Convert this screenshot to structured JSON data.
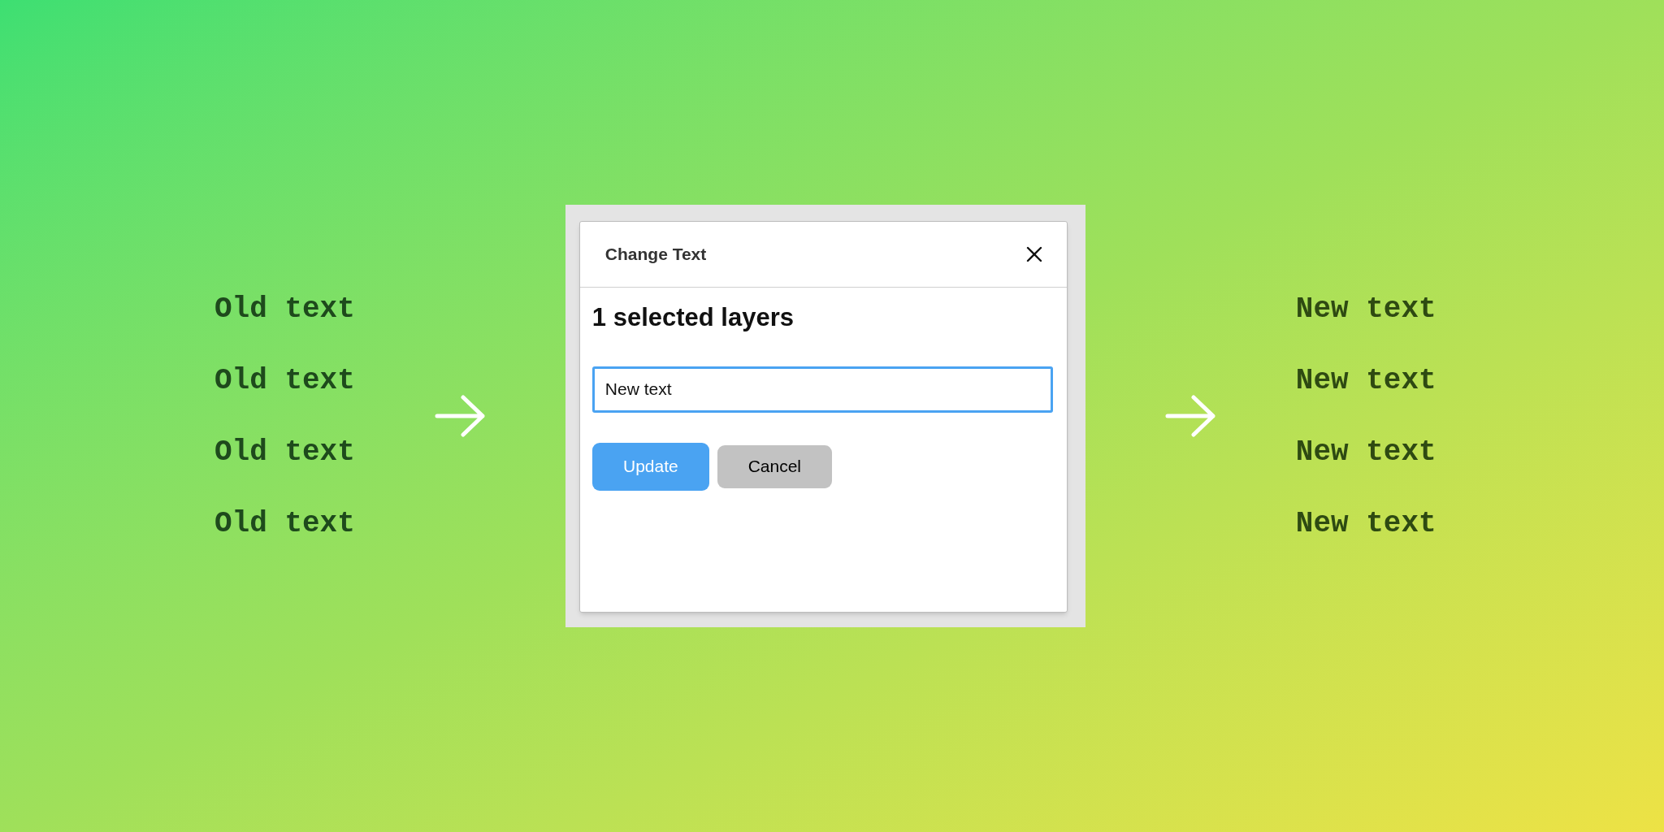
{
  "old_texts": [
    "Old text",
    "Old text",
    "Old text",
    "Old text"
  ],
  "dialog": {
    "title": "Change Text",
    "heading": "1 selected layers",
    "input": {
      "value": "New text"
    },
    "buttons": [
      {
        "label": "Update",
        "kind": "primary"
      },
      {
        "label": "Cancel",
        "kind": "secondary"
      }
    ]
  },
  "new_texts": [
    "New text",
    "New text",
    "New text",
    "New text"
  ]
}
